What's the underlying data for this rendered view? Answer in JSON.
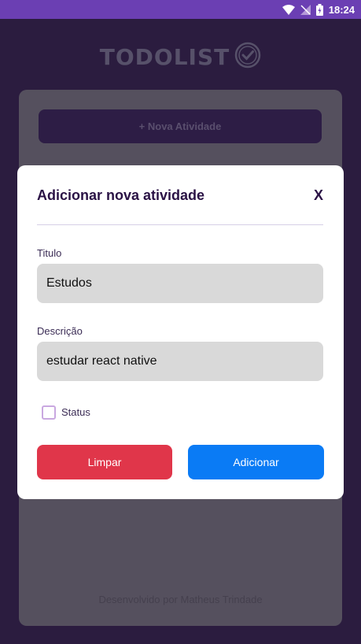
{
  "status_bar": {
    "time": "18:24",
    "icons": [
      "wifi-icon",
      "no-signal-icon",
      "battery-icon"
    ]
  },
  "app": {
    "logo_text": "TODOLIST",
    "new_activity_label": "+ Nova Atividade",
    "footer": "Desenvolvido por Matheus Trindade"
  },
  "modal": {
    "title": "Adicionar nova atividade",
    "close_label": "X",
    "title_field": {
      "label": "Titulo",
      "value": "Estudos"
    },
    "description_field": {
      "label": "Descrição",
      "value": "estudar react native"
    },
    "status": {
      "label": "Status",
      "checked": false
    },
    "clear_label": "Limpar",
    "add_label": "Adicionar"
  },
  "colors": {
    "status_bar": "#6b3fb3",
    "background": "#2b1c3f",
    "clear_button": "#e0364a",
    "add_button": "#0a7bf5",
    "modal_text": "#2a1245"
  }
}
